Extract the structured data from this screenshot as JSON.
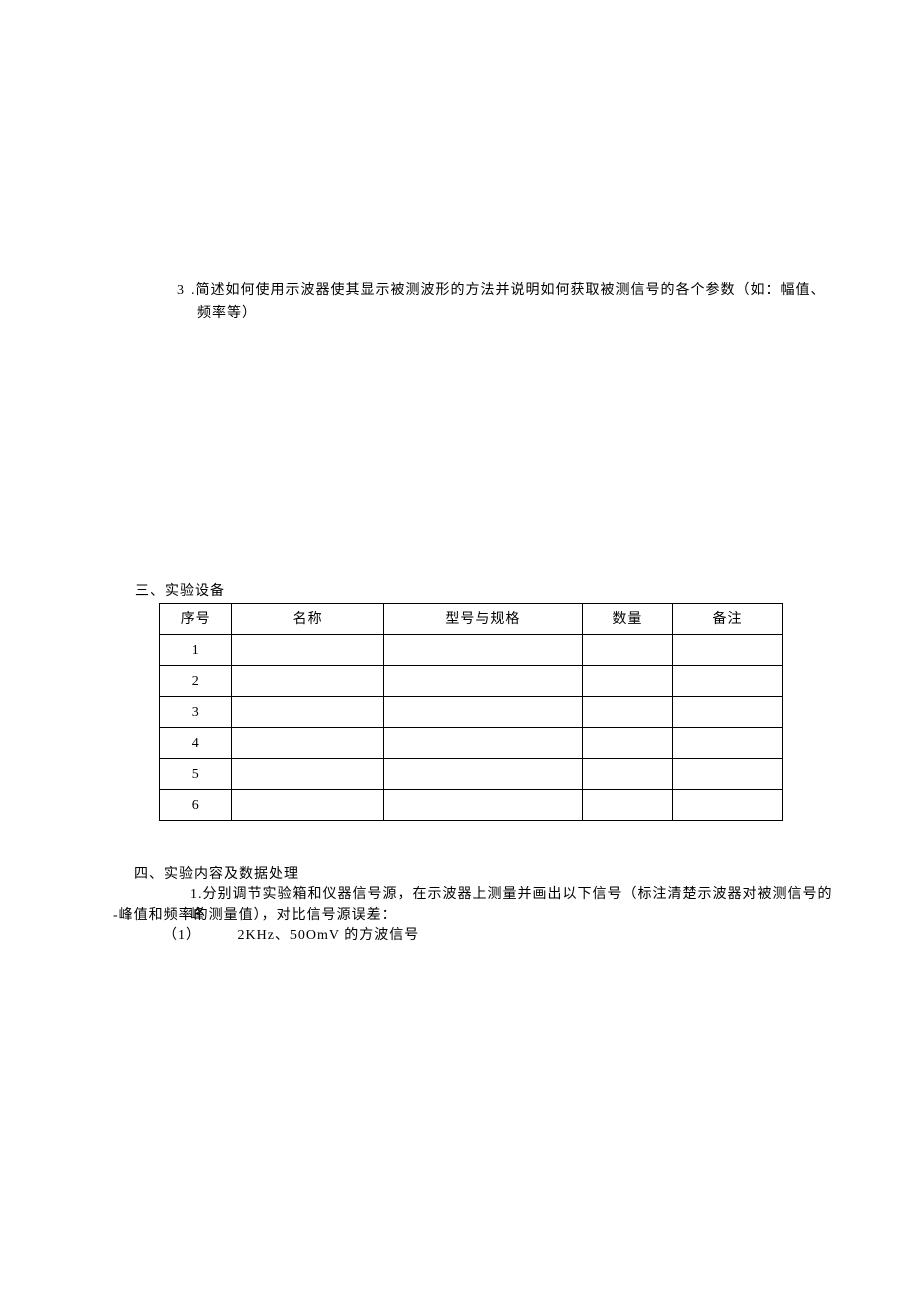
{
  "q3": {
    "num": "3",
    "text_line1": ".简述如何使用示波器使其显示被测波形的方法并说明如何获取被测信号的各个参数（如：幅值、",
    "text_line2": "频率等）"
  },
  "sec3": {
    "title": "三、实验设备",
    "headers": [
      "序号",
      "名称",
      "型号与规格",
      "数量",
      "备注"
    ],
    "rows": [
      {
        "no": "1",
        "name": "",
        "spec": "",
        "qty": "",
        "note": ""
      },
      {
        "no": "2",
        "name": "",
        "spec": "",
        "qty": "",
        "note": ""
      },
      {
        "no": "3",
        "name": "",
        "spec": "",
        "qty": "",
        "note": ""
      },
      {
        "no": "4",
        "name": "",
        "spec": "",
        "qty": "",
        "note": ""
      },
      {
        "no": "5",
        "name": "",
        "spec": "",
        "qty": "",
        "note": ""
      },
      {
        "no": "6",
        "name": "",
        "spec": "",
        "qty": "",
        "note": ""
      }
    ]
  },
  "sec4": {
    "title": "四、实验内容及数据处理",
    "line1": "1.分别调节实验箱和仪器信号源，在示波器上测量并画出以下信号（标注清楚示波器对被测信号的峰",
    "line2": "-峰值和频率的测量值），对比信号源误差：",
    "sub1_num": "（1）",
    "sub1_label": "2KHz、50OmV 的方波信号"
  }
}
